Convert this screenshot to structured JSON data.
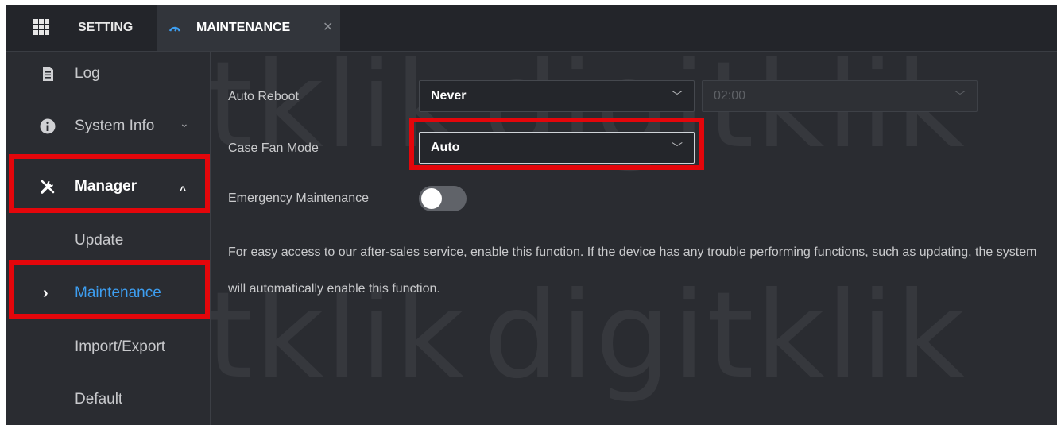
{
  "topbar": {
    "setting_label": "SETTING",
    "active_tab": {
      "label": "MAINTENANCE",
      "close_symbol": "✕"
    }
  },
  "sidebar": {
    "items": [
      {
        "label": "Log",
        "icon": "document-icon"
      },
      {
        "label": "System Info",
        "icon": "info-icon",
        "chevron": "⌄"
      },
      {
        "label": "Manager",
        "icon": "tools-icon",
        "chevron": "^"
      },
      {
        "label": "Update"
      },
      {
        "label": "Maintenance",
        "marker": "›"
      },
      {
        "label": "Import/Export"
      },
      {
        "label": "Default"
      }
    ]
  },
  "form": {
    "auto_reboot": {
      "label": "Auto Reboot",
      "day_value": "Never",
      "time_value": "02:00"
    },
    "case_fan_mode": {
      "label": "Case Fan Mode",
      "value": "Auto"
    },
    "emergency_maintenance": {
      "label": "Emergency Maintenance",
      "enabled": false
    },
    "description": "For easy access to our after-sales service, enable this function. If the device has any trouble performing functions, such as updating, the system will automatically enable this function."
  },
  "watermark": "digitklik",
  "colors": {
    "accent": "#3d9ef0",
    "highlight": "#e4060b",
    "background": "#2a2c31"
  }
}
